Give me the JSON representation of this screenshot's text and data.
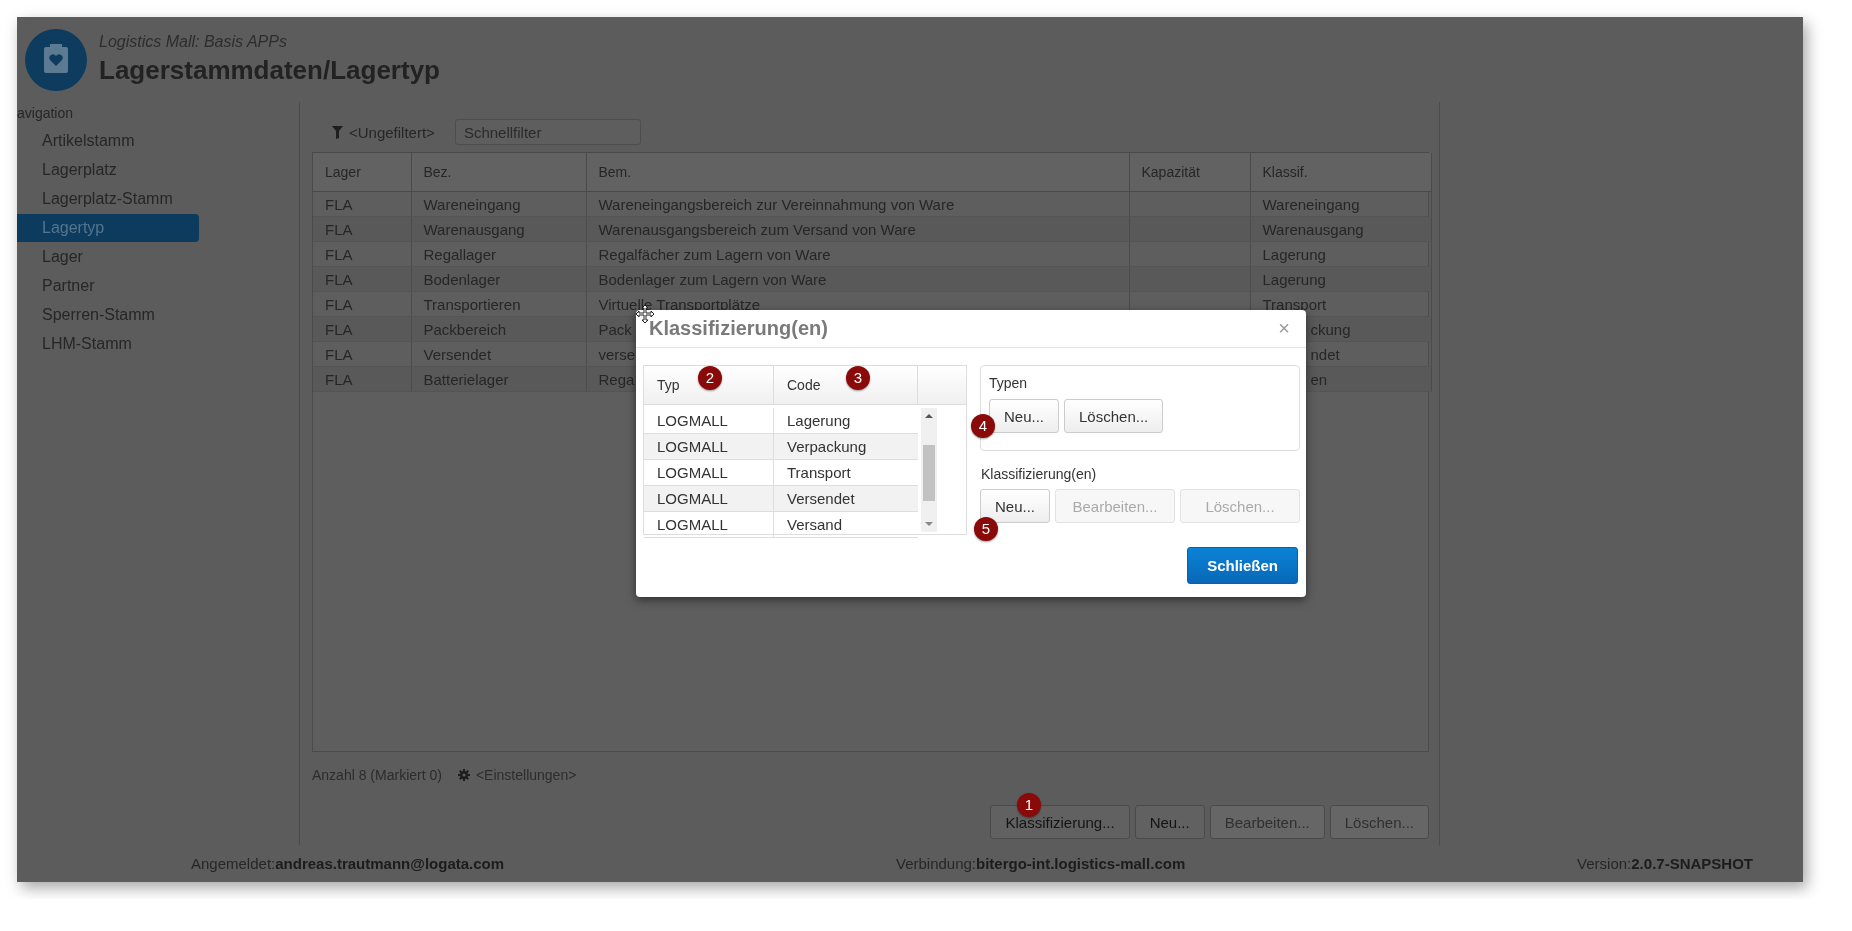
{
  "app": {
    "subtitle": "Logistics Mall: Basis APPs",
    "title": "Lagerstammdaten/Lagertyp"
  },
  "navigation": {
    "label": "avigation",
    "items": [
      {
        "label": "Artikelstamm",
        "selected": false
      },
      {
        "label": "Lagerplatz",
        "selected": false
      },
      {
        "label": "Lagerplatz-Stamm",
        "selected": false
      },
      {
        "label": "Lagertyp",
        "selected": true
      },
      {
        "label": "Lager",
        "selected": false
      },
      {
        "label": "Partner",
        "selected": false
      },
      {
        "label": "Sperren-Stamm",
        "selected": false
      },
      {
        "label": "LHM-Stamm",
        "selected": false
      }
    ]
  },
  "filter": {
    "label": "<Ungefiltert>",
    "placeholder": "Schnellfilter"
  },
  "table": {
    "columns": [
      "Lager",
      "Bez.",
      "Bem.",
      "Kapazität",
      "Klassif."
    ],
    "rows": [
      {
        "covered": false,
        "cells": [
          "FLA",
          "Wareneingang",
          "Wareneingangsbereich zur Vereinnahmung von Ware",
          "",
          "Wareneingang"
        ]
      },
      {
        "covered": false,
        "cells": [
          "FLA",
          "Warenausgang",
          "Warenausgangsbereich zum Versand von Ware",
          "",
          "Warenausgang"
        ]
      },
      {
        "covered": false,
        "cells": [
          "FLA",
          "Regallager",
          "Regalfächer zum Lagern von Ware",
          "",
          "Lagerung"
        ]
      },
      {
        "covered": false,
        "cells": [
          "FLA",
          "Bodenlager",
          "Bodenlager zum Lagern von Ware",
          "",
          "Lagerung"
        ]
      },
      {
        "covered": false,
        "cells": [
          "FLA",
          "Transportieren",
          "Virtuelle Transportplätze",
          "",
          "Transport"
        ]
      },
      {
        "covered": true,
        "cells": [
          "FLA",
          "Packbereich",
          "Pack",
          "",
          "ckung"
        ]
      },
      {
        "covered": true,
        "cells": [
          "FLA",
          "Versendet",
          "verse",
          "",
          "ndet"
        ]
      },
      {
        "covered": true,
        "cells": [
          "FLA",
          "Batterielager",
          "Rega",
          "",
          "en"
        ]
      }
    ]
  },
  "footer": {
    "count": "Anzahl 8 (Markiert 0)",
    "settings": "<Einstellungen>",
    "marker": "1",
    "buttons": [
      {
        "label": "Klassifizierung...",
        "disabled": false
      },
      {
        "label": "Neu...",
        "disabled": false
      },
      {
        "label": "Bearbeiten...",
        "disabled": true
      },
      {
        "label": "Löschen...",
        "disabled": true
      }
    ]
  },
  "status_bar": {
    "login_label": "Angemeldet:",
    "login": "andreas.trautmann@logata.com",
    "connection_label": "Verbindung:",
    "connection": "bitergo-int.logistics-mall.com",
    "version_label": "Version:",
    "version": "2.0.7-SNAPSHOT"
  },
  "dialog": {
    "title": "Klassifizierung(en)",
    "close": "×",
    "columns": [
      {
        "label": "Typ",
        "marker": "2"
      },
      {
        "label": "Code",
        "marker": "3"
      }
    ],
    "rows": [
      [
        "LOGMALL",
        "Lagerung"
      ],
      [
        "LOGMALL",
        "Verpackung"
      ],
      [
        "LOGMALL",
        "Transport"
      ],
      [
        "LOGMALL",
        "Versendet"
      ],
      [
        "LOGMALL",
        "Versand"
      ]
    ],
    "types_group": {
      "title": "Typen",
      "marker": "4",
      "buttons": [
        {
          "label": "Neu...",
          "disabled": false
        },
        {
          "label": "Löschen...",
          "disabled": false
        }
      ]
    },
    "class_group": {
      "title": "Klassifizierung(en)",
      "marker": "5",
      "buttons": [
        {
          "label": "Neu...",
          "disabled": false
        },
        {
          "label": "Bearbeiten...",
          "disabled": true
        },
        {
          "label": "Löschen...",
          "disabled": true
        }
      ]
    },
    "close_button": "Schließen"
  }
}
